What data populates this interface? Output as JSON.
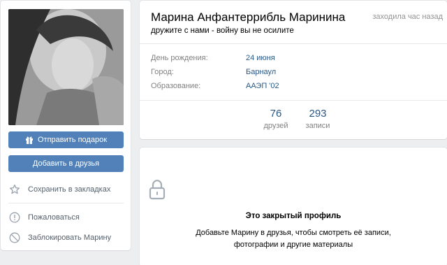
{
  "profile": {
    "name": "Марина Анфантеррибль Маринина",
    "status": "дружите с нами - войну вы не осилите",
    "online": "заходила час назад"
  },
  "info": [
    {
      "label": "День рождения:",
      "value": "24 июня"
    },
    {
      "label": "Город:",
      "value": "Барнаул"
    },
    {
      "label": "Образование:",
      "value": "ААЭП '02"
    }
  ],
  "counters": [
    {
      "num": "76",
      "label": "друзей"
    },
    {
      "num": "293",
      "label": "записи"
    }
  ],
  "actions": {
    "gift": "Отправить подарок",
    "add_friend": "Добавить в друзья",
    "bookmark": "Сохранить в закладках",
    "report": "Пожаловаться",
    "block": "Заблокировать Марину"
  },
  "closed": {
    "title": "Это закрытый профиль",
    "text_line1": "Добавьте Марину в друзья, чтобы смотреть её записи,",
    "text_line2": "фотографии и другие материалы"
  },
  "colors": {
    "accent": "#5181b8",
    "link": "#2a5885",
    "muted": "#828282",
    "background": "#edeef0"
  }
}
